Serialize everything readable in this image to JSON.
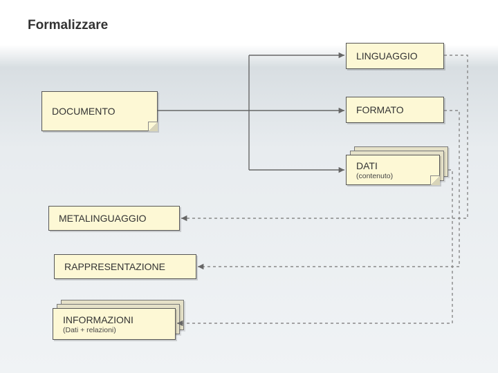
{
  "title": "Formalizzare",
  "nodes": {
    "documento": "DOCUMENTO",
    "linguaggio": "LINGUAGGIO",
    "formato": "FORMATO",
    "dati": "DATI",
    "dati_sub": "(contenuto)",
    "metalinguaggio": "METALINGUAGGIO",
    "rappresentazione": "RAPPRESENTAZIONE",
    "informazioni": "INFORMAZIONI",
    "informazioni_sub": "(Dati + relazioni)"
  }
}
